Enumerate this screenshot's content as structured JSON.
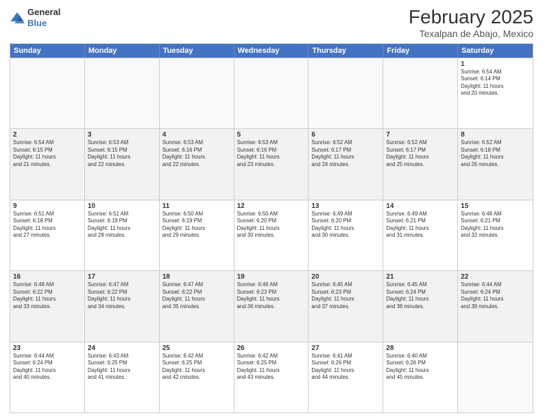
{
  "logo": {
    "general": "General",
    "blue": "Blue"
  },
  "title": "February 2025",
  "subtitle": "Texalpan de Abajo, Mexico",
  "days_of_week": [
    "Sunday",
    "Monday",
    "Tuesday",
    "Wednesday",
    "Thursday",
    "Friday",
    "Saturday"
  ],
  "weeks": [
    [
      {
        "day": "",
        "info": ""
      },
      {
        "day": "",
        "info": ""
      },
      {
        "day": "",
        "info": ""
      },
      {
        "day": "",
        "info": ""
      },
      {
        "day": "",
        "info": ""
      },
      {
        "day": "",
        "info": ""
      },
      {
        "day": "1",
        "info": "Sunrise: 6:54 AM\nSunset: 6:14 PM\nDaylight: 11 hours\nand 20 minutes."
      }
    ],
    [
      {
        "day": "2",
        "info": "Sunrise: 6:54 AM\nSunset: 6:15 PM\nDaylight: 11 hours\nand 21 minutes."
      },
      {
        "day": "3",
        "info": "Sunrise: 6:53 AM\nSunset: 6:15 PM\nDaylight: 11 hours\nand 22 minutes."
      },
      {
        "day": "4",
        "info": "Sunrise: 6:53 AM\nSunset: 6:16 PM\nDaylight: 11 hours\nand 22 minutes."
      },
      {
        "day": "5",
        "info": "Sunrise: 6:53 AM\nSunset: 6:16 PM\nDaylight: 11 hours\nand 23 minutes."
      },
      {
        "day": "6",
        "info": "Sunrise: 6:52 AM\nSunset: 6:17 PM\nDaylight: 11 hours\nand 24 minutes."
      },
      {
        "day": "7",
        "info": "Sunrise: 6:52 AM\nSunset: 6:17 PM\nDaylight: 11 hours\nand 25 minutes."
      },
      {
        "day": "8",
        "info": "Sunrise: 6:52 AM\nSunset: 6:18 PM\nDaylight: 11 hours\nand 26 minutes."
      }
    ],
    [
      {
        "day": "9",
        "info": "Sunrise: 6:51 AM\nSunset: 6:18 PM\nDaylight: 11 hours\nand 27 minutes."
      },
      {
        "day": "10",
        "info": "Sunrise: 6:51 AM\nSunset: 6:19 PM\nDaylight: 11 hours\nand 28 minutes."
      },
      {
        "day": "11",
        "info": "Sunrise: 6:50 AM\nSunset: 6:19 PM\nDaylight: 11 hours\nand 29 minutes."
      },
      {
        "day": "12",
        "info": "Sunrise: 6:50 AM\nSunset: 6:20 PM\nDaylight: 11 hours\nand 30 minutes."
      },
      {
        "day": "13",
        "info": "Sunrise: 6:49 AM\nSunset: 6:20 PM\nDaylight: 11 hours\nand 30 minutes."
      },
      {
        "day": "14",
        "info": "Sunrise: 6:49 AM\nSunset: 6:21 PM\nDaylight: 11 hours\nand 31 minutes."
      },
      {
        "day": "15",
        "info": "Sunrise: 6:48 AM\nSunset: 6:21 PM\nDaylight: 11 hours\nand 32 minutes."
      }
    ],
    [
      {
        "day": "16",
        "info": "Sunrise: 6:48 AM\nSunset: 6:22 PM\nDaylight: 11 hours\nand 33 minutes."
      },
      {
        "day": "17",
        "info": "Sunrise: 6:47 AM\nSunset: 6:22 PM\nDaylight: 11 hours\nand 34 minutes."
      },
      {
        "day": "18",
        "info": "Sunrise: 6:47 AM\nSunset: 6:22 PM\nDaylight: 11 hours\nand 35 minutes."
      },
      {
        "day": "19",
        "info": "Sunrise: 6:46 AM\nSunset: 6:23 PM\nDaylight: 11 hours\nand 36 minutes."
      },
      {
        "day": "20",
        "info": "Sunrise: 6:45 AM\nSunset: 6:23 PM\nDaylight: 11 hours\nand 37 minutes."
      },
      {
        "day": "21",
        "info": "Sunrise: 6:45 AM\nSunset: 6:24 PM\nDaylight: 11 hours\nand 38 minutes."
      },
      {
        "day": "22",
        "info": "Sunrise: 6:44 AM\nSunset: 6:24 PM\nDaylight: 11 hours\nand 39 minutes."
      }
    ],
    [
      {
        "day": "23",
        "info": "Sunrise: 6:44 AM\nSunset: 6:24 PM\nDaylight: 11 hours\nand 40 minutes."
      },
      {
        "day": "24",
        "info": "Sunrise: 6:43 AM\nSunset: 6:25 PM\nDaylight: 11 hours\nand 41 minutes."
      },
      {
        "day": "25",
        "info": "Sunrise: 6:42 AM\nSunset: 6:25 PM\nDaylight: 11 hours\nand 42 minutes."
      },
      {
        "day": "26",
        "info": "Sunrise: 6:42 AM\nSunset: 6:25 PM\nDaylight: 11 hours\nand 43 minutes."
      },
      {
        "day": "27",
        "info": "Sunrise: 6:41 AM\nSunset: 6:26 PM\nDaylight: 11 hours\nand 44 minutes."
      },
      {
        "day": "28",
        "info": "Sunrise: 6:40 AM\nSunset: 6:26 PM\nDaylight: 11 hours\nand 45 minutes."
      },
      {
        "day": "",
        "info": ""
      }
    ]
  ]
}
